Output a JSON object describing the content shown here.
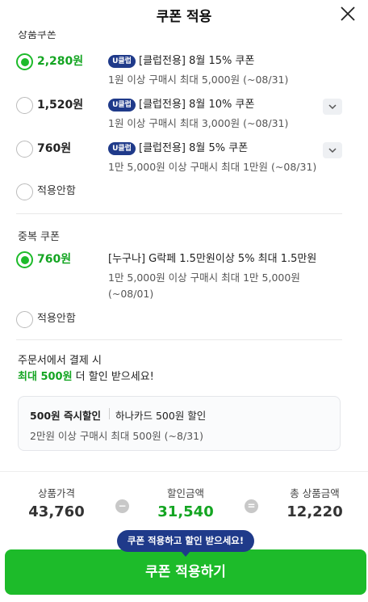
{
  "header": {
    "title": "쿠폰 적용"
  },
  "section1": {
    "heading_partial": "상품쿠폰",
    "coupons": [
      {
        "price": "2,280원",
        "badge": "U클럽",
        "name": "[클럽전용] 8월 15% 쿠폰",
        "desc": "1원 이상 구매시 최대 5,000원 (~08/31)",
        "selected": true
      },
      {
        "price": "1,520원",
        "badge": "U클럽",
        "name": "[클럽전용] 8월 10% 쿠폰",
        "desc": "1원 이상 구매시 최대 3,000원 (~08/31)",
        "selected": false
      },
      {
        "price": "760원",
        "badge": "U클럽",
        "name": "[클럽전용] 8월 5% 쿠폰",
        "desc": "1만 5,000원 이상 구매시 최대 1만원 (~08/31)",
        "selected": false
      }
    ],
    "not_apply": "적용안함"
  },
  "section2": {
    "title": "중복 쿠폰",
    "coupon": {
      "price": "760원",
      "name": "[누구나] G락페 1.5만원이상 5% 최대 1.5만원",
      "desc": "1만 5,000원 이상 구매시 최대 1만 5,000원 (~08/01)",
      "selected": true
    },
    "not_apply": "적용안함"
  },
  "promo": {
    "line1": "주문서에서 결제 시",
    "highlight": "최대 500원",
    "line2_rest": " 더 할인 받으세요!",
    "box_bold": "500원 즉시할인",
    "box_card": "하나카드 500원 할인",
    "box_cond": "2만원 이상 구매시 최대 500원 (~8/31)"
  },
  "summary": {
    "product_label": "상품가격",
    "product_value": "43,760",
    "minus": "−",
    "discount_label": "할인금액",
    "discount_value": "31,540",
    "equals": "=",
    "total_label": "총 상품금액",
    "total_value": "12,220"
  },
  "tooltip": "쿠폰 적용하고 할인 받으세요!",
  "apply_button": "쿠폰 적용하기",
  "colors": {
    "accent": "#1dbb2a",
    "badge": "#1f3a8a"
  }
}
